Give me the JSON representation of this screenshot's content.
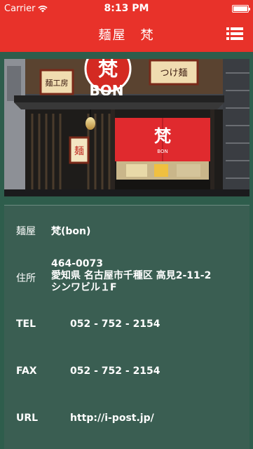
{
  "statusbar": {
    "carrier": "Carrier",
    "time": "8:13 PM"
  },
  "navbar": {
    "title": "麺屋　梵"
  },
  "hero": {
    "sign_left": "麺工房",
    "sign_right": "つけ麺",
    "logo_text": "BON",
    "curtain_logo": "梵",
    "curtain_sub": "BON",
    "lantern_text": "麺"
  },
  "shop": {
    "name_label": "麺屋",
    "name_value": "梵(bon)",
    "address_label": "住所",
    "address_lines": [
      "464-0073",
      "愛知県 名古屋市千種区 高見2-11-2",
      "シンワビル１F"
    ],
    "tel_label": "TEL",
    "tel_value": "052 - 752 - 2154",
    "fax_label": "FAX",
    "fax_value": "052 - 752 - 2154",
    "url_label": "URL",
    "url_value": "http://i-post.jp/"
  }
}
